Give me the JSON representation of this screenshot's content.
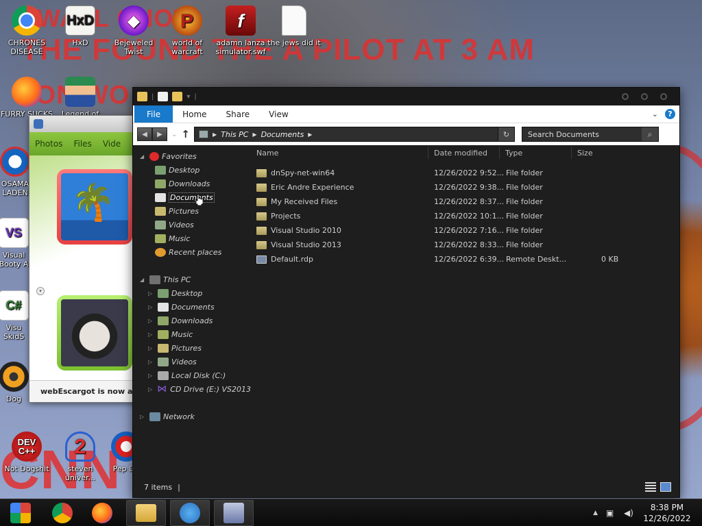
{
  "wallpaper": {
    "line1": "WALL CHOW",
    "line2": "THE FOUND THE A PILOT AT 3 AM",
    "line3": "ION WO",
    "corner": "CNN"
  },
  "desktop_icons": [
    {
      "label": "CHRONES DISEASE",
      "icon": "chrome-icon"
    },
    {
      "label": "HxD",
      "icon": "hxd-icon",
      "glyph": "HxD"
    },
    {
      "label": "Bejeweled Twist",
      "icon": "gem-icon",
      "glyph": "◆"
    },
    {
      "label": "world of warcraft",
      "icon": "warcraft-icon",
      "glyph": "P"
    },
    {
      "label": "adamn lanza simulator.swf",
      "icon": "flash-icon",
      "glyph": "f"
    },
    {
      "label": "the jews did it",
      "icon": "blank-file-icon"
    },
    {
      "label": "FURRY SUCKS",
      "icon": "firefox-icon"
    },
    {
      "label": "Legend of",
      "icon": "pixel-character-icon"
    },
    {
      "label": "OSAMA LADEN",
      "icon": "obama-logo-icon"
    },
    {
      "label": "Visual Booty A",
      "icon": "visual-studio-icon",
      "glyph": "VS"
    },
    {
      "label": "Visu SkidS",
      "icon": "visual-studio-green-icon",
      "glyph": "C#"
    },
    {
      "label": "Dog",
      "icon": "dog-icon"
    },
    {
      "label": "Not Dogshit",
      "icon": "devcpp-icon",
      "glyph": "DEV C++"
    },
    {
      "label": "steven univer...",
      "icon": "steven-icon",
      "glyph": "2"
    },
    {
      "label": "Pep De",
      "icon": "pepsi-icon"
    }
  ],
  "photos_window": {
    "nav": [
      "Photos",
      "Files",
      "Vide"
    ],
    "status": "webEscargot is now ava"
  },
  "explorer": {
    "ribbon_tabs": [
      "File",
      "Home",
      "Share",
      "View"
    ],
    "breadcrumb": [
      "This PC",
      "Documents"
    ],
    "search_placeholder": "Search Documents",
    "nav": {
      "favorites": {
        "label": "Favorites",
        "items": [
          "Desktop",
          "Downloads",
          "Documents",
          "Pictures",
          "Videos",
          "Music",
          "Recent places"
        ]
      },
      "this_pc": {
        "label": "This PC",
        "items": [
          "Desktop",
          "Documents",
          "Downloads",
          "Music",
          "Pictures",
          "Videos",
          "Local Disk (C:)",
          "CD Drive (E:) VS2013"
        ]
      },
      "network": {
        "label": "Network"
      }
    },
    "columns": {
      "name": "Name",
      "date": "Date modified",
      "type": "Type",
      "size": "Size"
    },
    "files": [
      {
        "name": "dnSpy-net-win64",
        "date": "12/26/2022 9:52...",
        "type": "File folder",
        "size": "",
        "kind": "folder"
      },
      {
        "name": "Eric Andre Experience",
        "date": "12/26/2022 9:38...",
        "type": "File folder",
        "size": "",
        "kind": "folder"
      },
      {
        "name": "My Received Files",
        "date": "12/26/2022 8:37...",
        "type": "File folder",
        "size": "",
        "kind": "folder"
      },
      {
        "name": "Projects",
        "date": "12/26/2022 10:1...",
        "type": "File folder",
        "size": "",
        "kind": "folder"
      },
      {
        "name": "Visual Studio 2010",
        "date": "12/26/2022 7:16...",
        "type": "File folder",
        "size": "",
        "kind": "folder"
      },
      {
        "name": "Visual Studio 2013",
        "date": "12/26/2022 8:33...",
        "type": "File folder",
        "size": "",
        "kind": "folder"
      },
      {
        "name": "Default.rdp",
        "date": "12/26/2022 6:39...",
        "type": "Remote Deskt...",
        "size": "0 KB",
        "kind": "rdp"
      }
    ],
    "status": "7 items"
  },
  "taskbar": {
    "time": "8:38 PM",
    "date": "12/26/2022"
  }
}
